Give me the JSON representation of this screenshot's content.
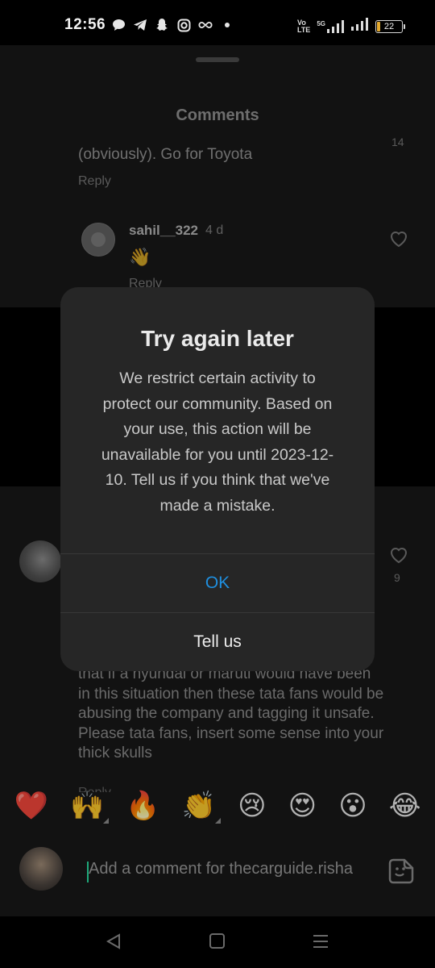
{
  "status_bar": {
    "time": "12:56",
    "network_label": "Vo LTE",
    "network_label_top": "Vo",
    "network_label_bottom": "LTE",
    "signal_label": "5G",
    "battery": "22",
    "icons": [
      "chat-icon",
      "telegram-icon",
      "snapchat-icon",
      "instagram-icon",
      "infinity-icon",
      "dot-icon"
    ]
  },
  "sheet": {
    "title": "Comments",
    "comment1": {
      "text": "(obviously). Go for Toyota",
      "likes": "14",
      "reply_label": "Reply"
    },
    "reply": {
      "username": "sahil__322",
      "time": "4 d",
      "emoji": "👋",
      "reply_label": "Reply"
    },
    "comment2": {
      "likes": "9",
      "text": "that if a hyundai or maruti would have been in this situation then these tata fans would be abusing the company and tagging it unsafe. Please tata fans, insert some sense into your thick skulls",
      "reply_label": "Reply"
    }
  },
  "dialog": {
    "title": "Try again later",
    "body": "We restrict certain activity to protect our community. Based on your use, this action will be unavailable for you until 2023-12-10. Tell us if you think that we've made a mistake.",
    "ok_label": "OK",
    "tell_label": "Tell us"
  },
  "emoji_bar": [
    "❤️",
    "🙌",
    "🔥",
    "👏",
    "😢",
    "😍",
    "😮",
    "😂"
  ],
  "composer": {
    "placeholder": "Add a comment for thecarguide.risha"
  },
  "colors": {
    "accent_blue": "#1f8fdf",
    "caret_green": "#1ea87a",
    "battery_fill": "#e3a92e"
  }
}
